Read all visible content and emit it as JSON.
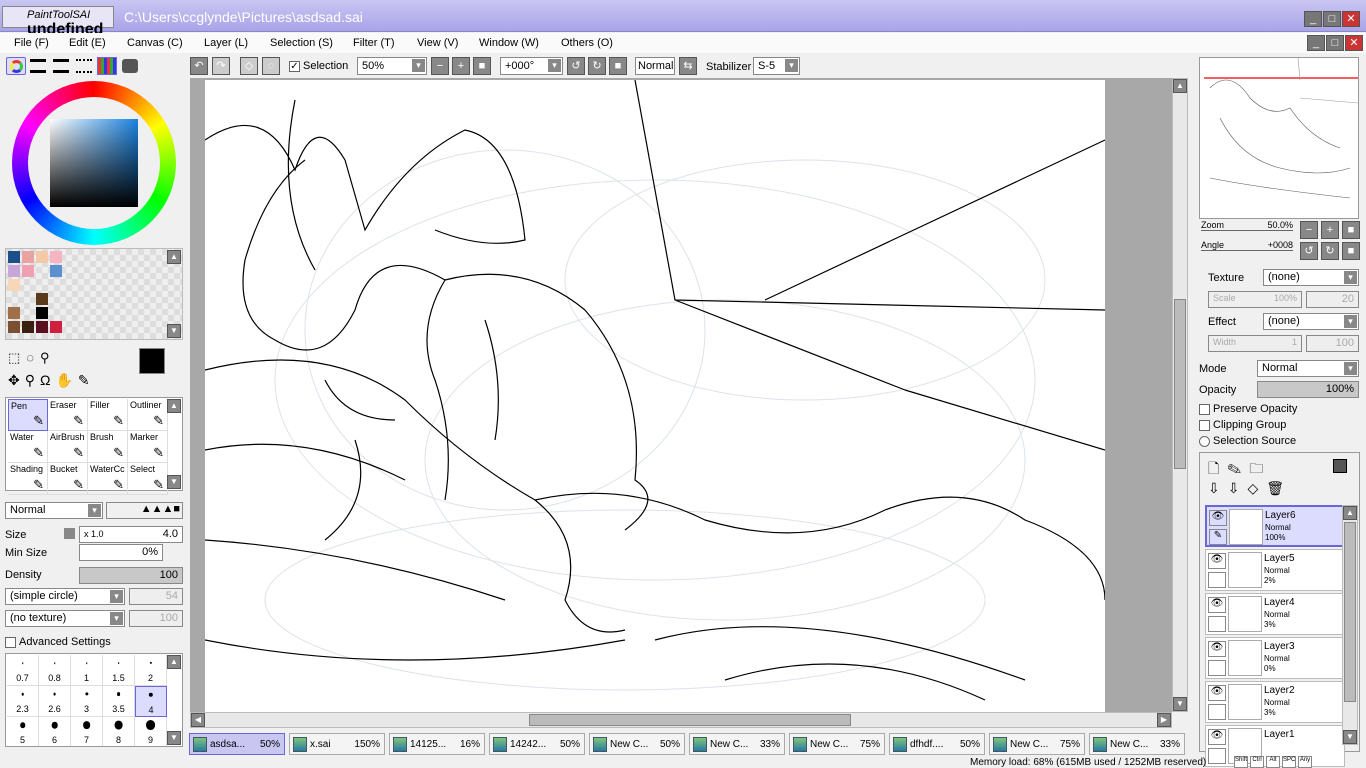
{
  "app": {
    "logo": "PaintTool SAI",
    "title": "C:\\Users\\ccglynde\\Pictures\\asdsad.sai"
  },
  "menu": [
    "File (F)",
    "Edit (E)",
    "Canvas (C)",
    "Layer (L)",
    "Selection (S)",
    "Filter (T)",
    "View (V)",
    "Window (W)",
    "Others (O)"
  ],
  "toolbar": {
    "selection_label": "Selection",
    "selection_checked": true,
    "zoom": "50%",
    "angle": "+000°",
    "blend": "Normal",
    "stabilizer_label": "Stabilizer",
    "stabilizer": "S-5"
  },
  "colors": {
    "accent": "#6a66d8",
    "titlebar": "#a9a4e8"
  },
  "tools": [
    {
      "label": "Pen"
    },
    {
      "label": "Eraser"
    },
    {
      "label": "Filler"
    },
    {
      "label": "Outliner"
    },
    {
      "label": "Water"
    },
    {
      "label": "AirBrush"
    },
    {
      "label": "Brush"
    },
    {
      "label": "Marker"
    },
    {
      "label": "Shading"
    },
    {
      "label": "Bucket"
    },
    {
      "label": "WaterCc"
    },
    {
      "label": "Select"
    }
  ],
  "brush": {
    "mode": "Normal",
    "size_label": "Size",
    "size_mult": "x 1.0",
    "size": "4.0",
    "min_size_label": "Min Size",
    "min_size": "0%",
    "density_label": "Density",
    "density": "100",
    "shape": "(simple circle)",
    "shape_val": "54",
    "texture": "(no texture)",
    "texture_val": "100",
    "advanced_label": "Advanced Settings"
  },
  "brush_sizes": [
    "0.7",
    "0.8",
    "1",
    "1.5",
    "2",
    "2.3",
    "2.6",
    "3",
    "3.5",
    "4",
    "5",
    "6",
    "7",
    "8",
    "9"
  ],
  "navigator": {
    "zoom_label": "Zoom",
    "zoom": "50.0%",
    "angle_label": "Angle",
    "angle": "+0008"
  },
  "paper": {
    "texture_label": "Texture",
    "texture": "(none)",
    "scale_label": "Scale",
    "scale": "100%",
    "scale_val": "20",
    "effect_label": "Effect",
    "effect": "(none)",
    "width_label": "Width",
    "width": "1",
    "width_val": "100"
  },
  "layer_props": {
    "mode_label": "Mode",
    "mode": "Normal",
    "opacity_label": "Opacity",
    "opacity": "100%",
    "preserve": "Preserve Opacity",
    "clipping": "Clipping Group",
    "selsource": "Selection Source"
  },
  "layers": [
    {
      "name": "Layer6",
      "mode": "Normal",
      "opacity": "100%"
    },
    {
      "name": "Layer5",
      "mode": "Normal",
      "opacity": "2%"
    },
    {
      "name": "Layer4",
      "mode": "Normal",
      "opacity": "3%"
    },
    {
      "name": "Layer3",
      "mode": "Normal",
      "opacity": "0%"
    },
    {
      "name": "Layer2",
      "mode": "Normal",
      "opacity": "3%"
    },
    {
      "name": "Layer1",
      "mode": "",
      "opacity": ""
    }
  ],
  "tabs": [
    {
      "name": "asdsa...",
      "zoom": "50%"
    },
    {
      "name": "x.sai",
      "zoom": "150%"
    },
    {
      "name": "14125...",
      "zoom": "16%"
    },
    {
      "name": "14242...",
      "zoom": "50%"
    },
    {
      "name": "New C...",
      "zoom": "50%"
    },
    {
      "name": "New C...",
      "zoom": "33%"
    },
    {
      "name": "New C...",
      "zoom": "75%"
    },
    {
      "name": "dfhdf....",
      "zoom": "50%"
    },
    {
      "name": "New C...",
      "zoom": "75%"
    },
    {
      "name": "New C...",
      "zoom": "33%"
    }
  ],
  "status": {
    "memory": "Memory load: 68% (615MB used / 1252MB reserved)",
    "keys": [
      "Shift",
      "Ctrl",
      "Alt",
      "SPC",
      "Any"
    ]
  }
}
